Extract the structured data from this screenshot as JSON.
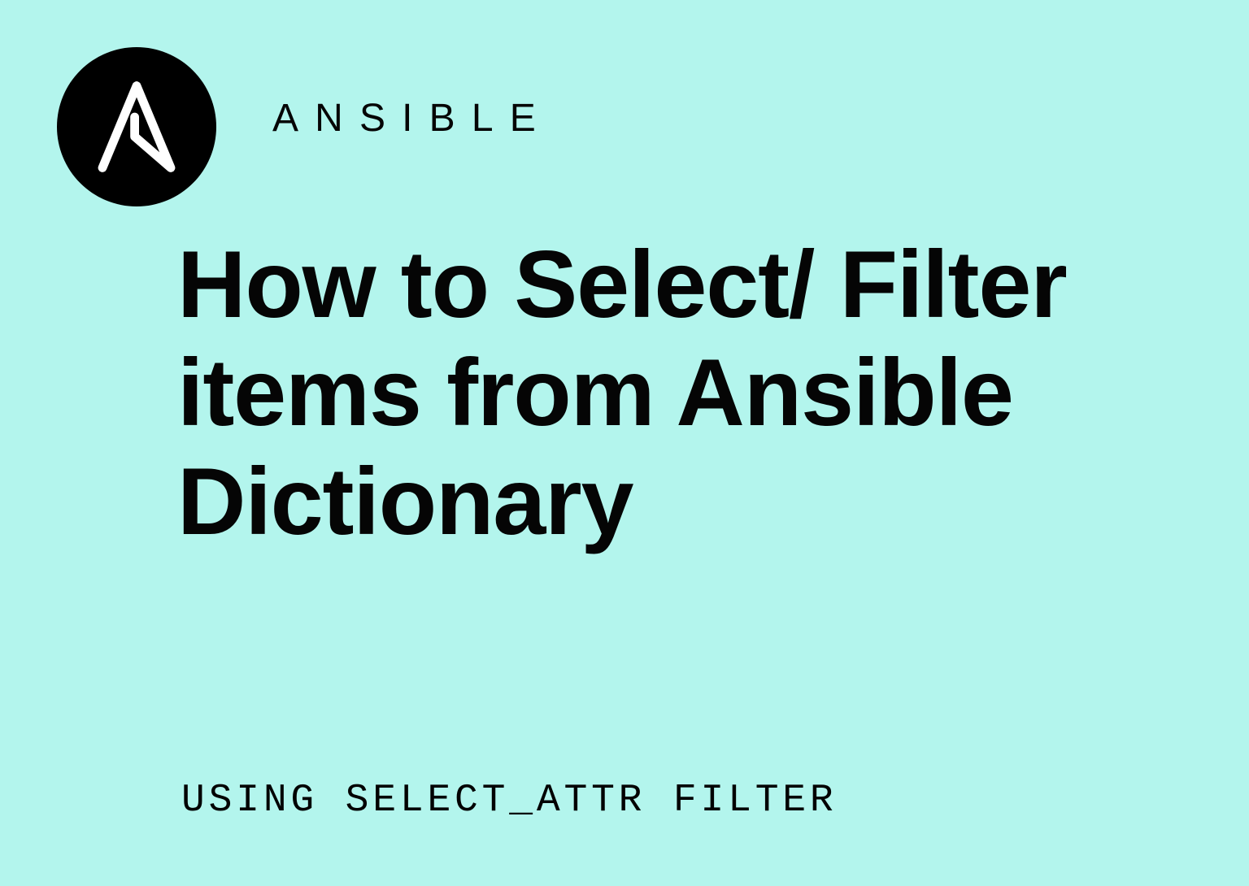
{
  "brand": "ANSIBLE",
  "title": "How to Select/ Filter items from Ansible Dictionary",
  "subtitle": "USING SELECT_ATTR FILTER",
  "colors": {
    "background": "#b3f5ed",
    "logo_bg": "#000000",
    "text": "#050505"
  }
}
